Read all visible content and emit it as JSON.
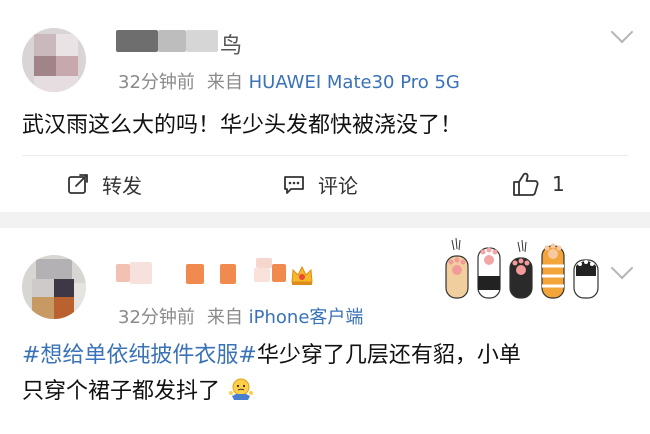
{
  "posts": [
    {
      "username_visible": "鸟",
      "time": "32分钟前",
      "source_prefix": "来自",
      "source_device": "HUAWEI Mate30 Pro 5G",
      "text": "武汉雨这么大的吗！华少头发都快被浇没了！",
      "actions": {
        "repost": "转发",
        "comment": "评论",
        "like_count": "1"
      }
    },
    {
      "time": "32分钟前",
      "source_prefix": "来自",
      "source_device": "iPhone客户端",
      "topic": "#想给单依纯披件衣服#",
      "text_line1": "华少穿了几层还有貂，小单",
      "text_line2": "只穿个裙子都发抖了"
    }
  ],
  "icons": [
    "repost-icon",
    "comment-icon",
    "like-icon",
    "chevron-down-icon",
    "crown-badge-icon",
    "cat-paws-sticker",
    "shrug-emoji"
  ],
  "colors": {
    "link_blue": "#3a72b8",
    "meta_gray": "#8a8a8a",
    "divider_gray": "#f2f2f2"
  }
}
